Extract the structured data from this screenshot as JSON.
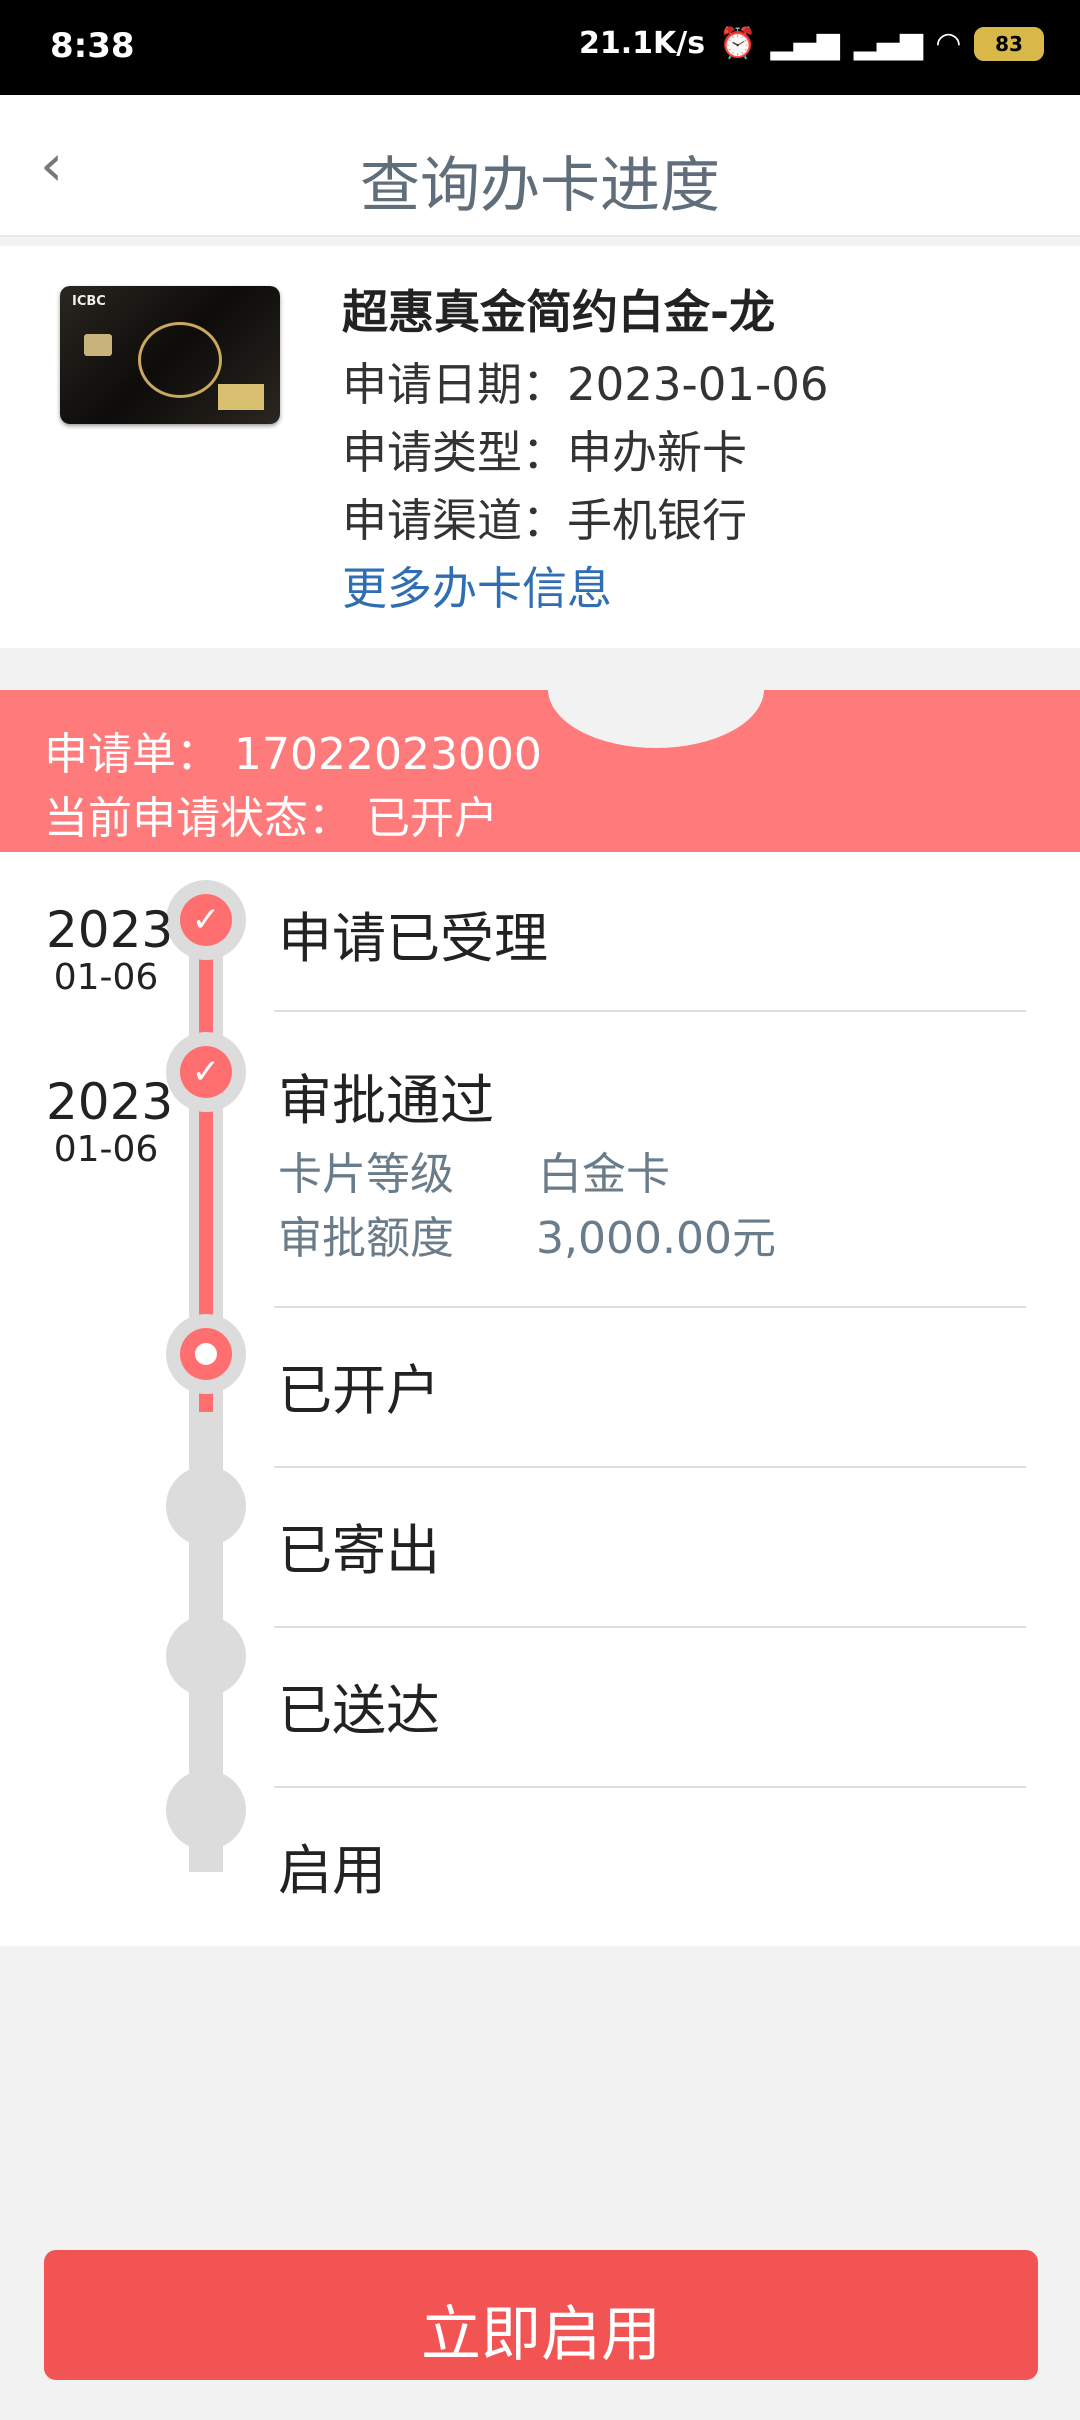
{
  "status_bar": {
    "time": "8:38",
    "net_speed": "21.1K/s",
    "battery": "83"
  },
  "nav": {
    "back_icon": "chevron-left-icon",
    "title": "查询办卡进度"
  },
  "card": {
    "name": "超惠真金简约白金-龙",
    "apply_date": "申请日期：2023-01-06",
    "apply_type": "申请类型：申办新卡",
    "apply_channel": "申请渠道：手机银行",
    "more_link": "更多办卡信息"
  },
  "application": {
    "number": "申请单：  17022023000",
    "status": "当前申请状态：  已开户"
  },
  "steps": [
    {
      "year": "2023",
      "date": "01-06",
      "title": "申请已受理",
      "state": "done"
    },
    {
      "year": "2023",
      "date": "01-06",
      "title": "审批通过",
      "state": "done",
      "details": [
        {
          "label": "卡片等级",
          "value": "白金卡"
        },
        {
          "label": "审批额度",
          "value": "3,000.00元"
        }
      ]
    },
    {
      "title": "已开户",
      "state": "current"
    },
    {
      "title": "已寄出",
      "state": "pending"
    },
    {
      "title": "已送达",
      "state": "pending"
    },
    {
      "title": "启用",
      "state": "pending"
    }
  ],
  "action": {
    "enable_label": "立即启用"
  },
  "colors": {
    "accent": "#ff7b7b",
    "button": "#f25454",
    "link": "#2f6eb3",
    "track": "#dcdcdc"
  }
}
